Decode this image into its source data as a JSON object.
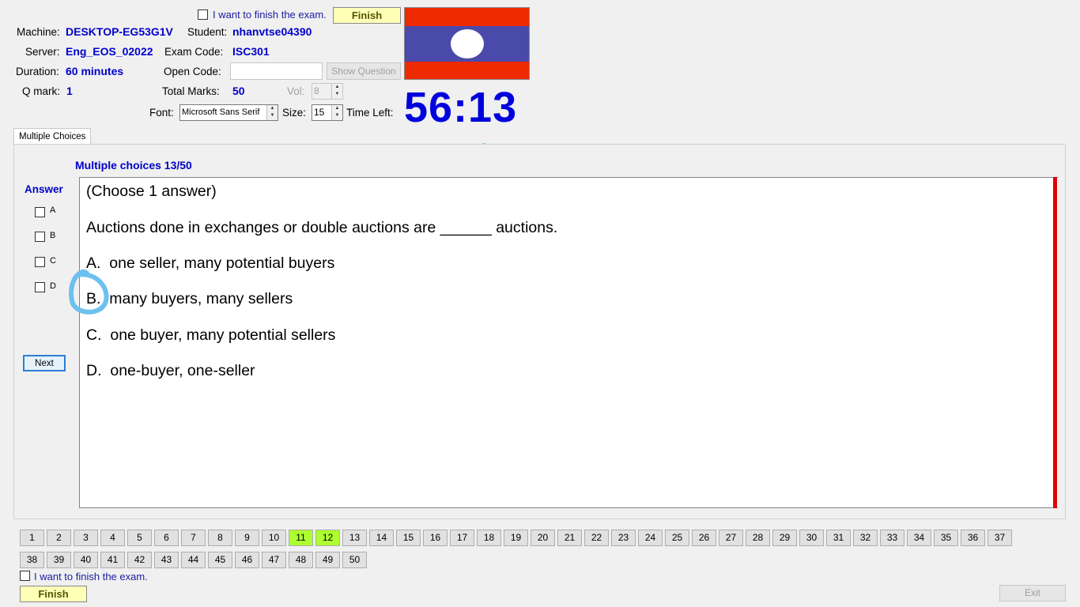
{
  "header": {
    "finish_check_label": "I want to finish the exam.",
    "finish_button": "Finish",
    "machine_label": "Machine:",
    "machine_value": "DESKTOP-EG53G1V",
    "student_label": "Student:",
    "student_value": "nhanvtse04390",
    "server_label": "Server:",
    "server_value": "Eng_EOS_02022",
    "exam_code_label": "Exam Code:",
    "exam_code_value": "ISC301",
    "duration_label": "Duration:",
    "duration_value": "60 minutes",
    "open_code_label": "Open Code:",
    "open_code_value": "",
    "show_question_button": "Show Question",
    "qmark_label": "Q mark:",
    "qmark_value": "1",
    "total_marks_label": "Total Marks:",
    "total_marks_value": "50",
    "vol_label": "Vol:",
    "vol_value": "8",
    "font_label": "Font:",
    "font_value": "Microsoft Sans Serif",
    "size_label": "Size:",
    "size_value": "15",
    "time_left_label": "Time Left:",
    "time_left_value": "56:13"
  },
  "flag": {
    "top_color": "#ee2a00",
    "middle_color": "#4a4aaa",
    "circle_color": "#ffffff"
  },
  "tabs": [
    {
      "label": "Multiple Choices",
      "active": true
    }
  ],
  "question": {
    "progress_label": "Multiple choices 13/50",
    "answer_label": "Answer",
    "answer_options": [
      "A",
      "B",
      "C",
      "D"
    ],
    "next_button": "Next",
    "instruction": "(Choose 1 answer)",
    "text": "Auctions done in exchanges or double auctions are ______ auctions.",
    "options": [
      {
        "letter": "A.",
        "text": "one seller, many potential buyers"
      },
      {
        "letter": "B.",
        "text": "many buyers, many sellers"
      },
      {
        "letter": "C.",
        "text": "one buyer, many potential sellers"
      },
      {
        "letter": "D.",
        "text": "one-buyer, one-seller"
      }
    ]
  },
  "navigation": {
    "total": 50,
    "answered": [
      11,
      12
    ]
  },
  "footer": {
    "finish_check_label": "I want to finish the exam.",
    "finish_button": "Finish",
    "exit_button": "Exit"
  }
}
